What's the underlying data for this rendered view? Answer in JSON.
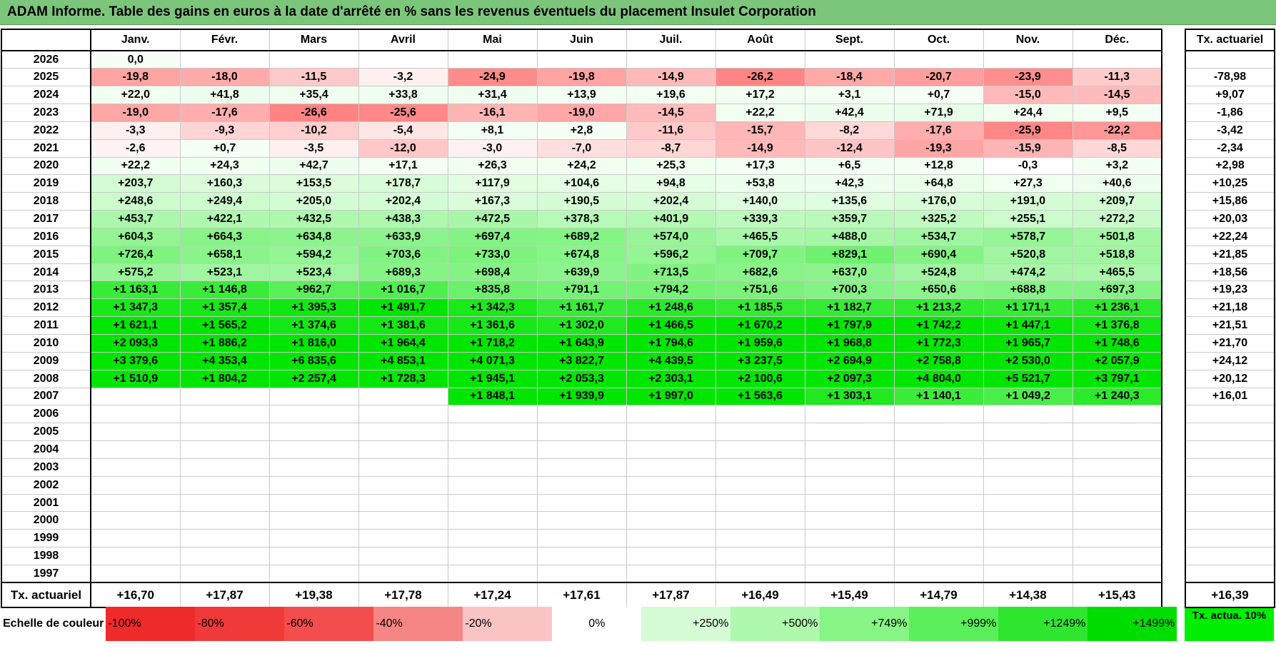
{
  "title": "ADAM Informe. Table des gains en euros à la date d'arrêté en % sans les revenus éventuels du placement Insulet Corporation",
  "chart_data": {
    "type": "table",
    "columns": [
      "Janv.",
      "Févr.",
      "Mars",
      "Avril",
      "Mai",
      "Juin",
      "Juil.",
      "Août",
      "Sept.",
      "Oct.",
      "Nov.",
      "Déc."
    ],
    "rate_header": "Tx. actuariel",
    "rows": [
      {
        "year": "2026",
        "values": [
          "0,0",
          "",
          "",
          "",
          "",
          "",
          "",
          "",
          "",
          "",
          "",
          ""
        ],
        "rate": ""
      },
      {
        "year": "2025",
        "values": [
          "-19,8",
          "-18,0",
          "-11,5",
          "-3,2",
          "-24,9",
          "-19,8",
          "-14,9",
          "-26,2",
          "-18,4",
          "-20,7",
          "-23,9",
          "-11,3"
        ],
        "rate": "-78,98"
      },
      {
        "year": "2024",
        "values": [
          "+22,0",
          "+41,8",
          "+35,4",
          "+33,8",
          "+31,4",
          "+13,9",
          "+19,6",
          "+17,2",
          "+3,1",
          "+0,7",
          "-15,0",
          "-14,5"
        ],
        "rate": "+9,07"
      },
      {
        "year": "2023",
        "values": [
          "-19,0",
          "-17,6",
          "-26,6",
          "-25,6",
          "-16,1",
          "-19,0",
          "-14,5",
          "+22,2",
          "+42,4",
          "+71,9",
          "+24,4",
          "+9,5"
        ],
        "rate": "-1,86"
      },
      {
        "year": "2022",
        "values": [
          "-3,3",
          "-9,3",
          "-10,2",
          "-5,4",
          "+8,1",
          "+2,8",
          "-11,6",
          "-15,7",
          "-8,2",
          "-17,6",
          "-25,9",
          "-22,2"
        ],
        "rate": "-3,42"
      },
      {
        "year": "2021",
        "values": [
          "-2,6",
          "+0,7",
          "-3,5",
          "-12,0",
          "-3,0",
          "-7,0",
          "-8,7",
          "-14,9",
          "-12,4",
          "-19,3",
          "-15,9",
          "-8,5"
        ],
        "rate": "-2,34"
      },
      {
        "year": "2020",
        "values": [
          "+22,2",
          "+24,3",
          "+42,7",
          "+17,1",
          "+26,3",
          "+24,2",
          "+25,3",
          "+17,3",
          "+6,5",
          "+12,8",
          "-0,3",
          "+3,2"
        ],
        "rate": "+2,98"
      },
      {
        "year": "2019",
        "values": [
          "+203,7",
          "+160,3",
          "+153,5",
          "+178,7",
          "+117,9",
          "+104,6",
          "+94,8",
          "+53,8",
          "+42,3",
          "+64,8",
          "+27,3",
          "+40,6"
        ],
        "rate": "+10,25"
      },
      {
        "year": "2018",
        "values": [
          "+248,6",
          "+249,4",
          "+205,0",
          "+202,4",
          "+167,3",
          "+190,5",
          "+202,4",
          "+140,0",
          "+135,6",
          "+176,0",
          "+191,0",
          "+209,7"
        ],
        "rate": "+15,86"
      },
      {
        "year": "2017",
        "values": [
          "+453,7",
          "+422,1",
          "+432,5",
          "+438,3",
          "+472,5",
          "+378,3",
          "+401,9",
          "+339,3",
          "+359,7",
          "+325,2",
          "+255,1",
          "+272,2"
        ],
        "rate": "+20,03"
      },
      {
        "year": "2016",
        "values": [
          "+604,3",
          "+664,3",
          "+634,8",
          "+633,9",
          "+697,4",
          "+689,2",
          "+574,0",
          "+465,5",
          "+488,0",
          "+534,7",
          "+578,7",
          "+501,8"
        ],
        "rate": "+22,24"
      },
      {
        "year": "2015",
        "values": [
          "+726,4",
          "+658,1",
          "+594,2",
          "+703,6",
          "+733,0",
          "+674,8",
          "+596,2",
          "+709,7",
          "+829,1",
          "+690,4",
          "+520,8",
          "+518,8"
        ],
        "rate": "+21,85"
      },
      {
        "year": "2014",
        "values": [
          "+575,2",
          "+523,1",
          "+523,4",
          "+689,3",
          "+698,4",
          "+639,9",
          "+713,5",
          "+682,6",
          "+637,0",
          "+524,8",
          "+474,2",
          "+465,5"
        ],
        "rate": "+18,56"
      },
      {
        "year": "2013",
        "values": [
          "+1 163,1",
          "+1 146,8",
          "+962,7",
          "+1 016,7",
          "+835,8",
          "+791,1",
          "+794,2",
          "+751,6",
          "+700,3",
          "+650,6",
          "+688,8",
          "+697,3"
        ],
        "rate": "+19,23"
      },
      {
        "year": "2012",
        "values": [
          "+1 347,3",
          "+1 357,4",
          "+1 395,3",
          "+1 491,7",
          "+1 342,3",
          "+1 161,7",
          "+1 248,6",
          "+1 185,5",
          "+1 182,7",
          "+1 213,2",
          "+1 171,1",
          "+1 236,1"
        ],
        "rate": "+21,18"
      },
      {
        "year": "2011",
        "values": [
          "+1 621,1",
          "+1 565,2",
          "+1 374,6",
          "+1 381,6",
          "+1 361,6",
          "+1 302,0",
          "+1 466,5",
          "+1 670,2",
          "+1 797,9",
          "+1 742,2",
          "+1 447,1",
          "+1 376,8"
        ],
        "rate": "+21,51"
      },
      {
        "year": "2010",
        "values": [
          "+2 093,3",
          "+1 886,2",
          "+1 816,0",
          "+1 964,4",
          "+1 718,2",
          "+1 643,9",
          "+1 794,6",
          "+1 959,6",
          "+1 968,8",
          "+1 772,3",
          "+1 965,7",
          "+1 748,6"
        ],
        "rate": "+21,70"
      },
      {
        "year": "2009",
        "values": [
          "+3 379,6",
          "+4 353,4",
          "+6 835,6",
          "+4 853,1",
          "+4 071,3",
          "+3 822,7",
          "+4 439,5",
          "+3 237,5",
          "+2 694,9",
          "+2 758,8",
          "+2 530,0",
          "+2 057,9"
        ],
        "rate": "+24,12"
      },
      {
        "year": "2008",
        "values": [
          "+1 510,9",
          "+1 804,2",
          "+2 257,4",
          "+1 728,3",
          "+1 945,1",
          "+2 053,3",
          "+2 303,1",
          "+2 100,6",
          "+2 097,3",
          "+4 804,0",
          "+5 521,7",
          "+3 797,1"
        ],
        "rate": "+20,12"
      },
      {
        "year": "2007",
        "values": [
          "",
          "",
          "",
          "",
          "+1 848,1",
          "+1 939,9",
          "+1 997,0",
          "+1 563,6",
          "+1 303,1",
          "+1 140,1",
          "+1 049,2",
          "+1 240,3"
        ],
        "rate": "+16,01"
      },
      {
        "year": "2006",
        "values": [
          "",
          "",
          "",
          "",
          "",
          "",
          "",
          "",
          "",
          "",
          "",
          ""
        ],
        "rate": ""
      },
      {
        "year": "2005",
        "values": [
          "",
          "",
          "",
          "",
          "",
          "",
          "",
          "",
          "",
          "",
          "",
          ""
        ],
        "rate": ""
      },
      {
        "year": "2004",
        "values": [
          "",
          "",
          "",
          "",
          "",
          "",
          "",
          "",
          "",
          "",
          "",
          ""
        ],
        "rate": ""
      },
      {
        "year": "2003",
        "values": [
          "",
          "",
          "",
          "",
          "",
          "",
          "",
          "",
          "",
          "",
          "",
          ""
        ],
        "rate": ""
      },
      {
        "year": "2002",
        "values": [
          "",
          "",
          "",
          "",
          "",
          "",
          "",
          "",
          "",
          "",
          "",
          ""
        ],
        "rate": ""
      },
      {
        "year": "2001",
        "values": [
          "",
          "",
          "",
          "",
          "",
          "",
          "",
          "",
          "",
          "",
          "",
          ""
        ],
        "rate": ""
      },
      {
        "year": "2000",
        "values": [
          "",
          "",
          "",
          "",
          "",
          "",
          "",
          "",
          "",
          "",
          "",
          ""
        ],
        "rate": ""
      },
      {
        "year": "1999",
        "values": [
          "",
          "",
          "",
          "",
          "",
          "",
          "",
          "",
          "",
          "",
          "",
          ""
        ],
        "rate": ""
      },
      {
        "year": "1998",
        "values": [
          "",
          "",
          "",
          "",
          "",
          "",
          "",
          "",
          "",
          "",
          "",
          ""
        ],
        "rate": ""
      },
      {
        "year": "1997",
        "values": [
          "",
          "",
          "",
          "",
          "",
          "",
          "",
          "",
          "",
          "",
          "",
          ""
        ],
        "rate": ""
      }
    ],
    "footer_label": "Tx. actuariel",
    "footer_values": [
      "+16,70",
      "+17,87",
      "+19,38",
      "+17,78",
      "+17,24",
      "+17,61",
      "+17,87",
      "+16,49",
      "+15,49",
      "+14,79",
      "+14,38",
      "+15,43"
    ],
    "footer_rate": "+16,39",
    "scale_label": "Echelle de couleur",
    "scale": [
      {
        "label": "-100%",
        "color": "#ee2a2a"
      },
      {
        "label": "-80%",
        "color": "#f03a3a"
      },
      {
        "label": "-60%",
        "color": "#f34d4d"
      },
      {
        "label": "-40%",
        "color": "#f68686"
      },
      {
        "label": "-20%",
        "color": "#fbc4c4"
      },
      {
        "label": "0%",
        "color": "#ffffff"
      },
      {
        "label": "+250%",
        "color": "#d6fcd6"
      },
      {
        "label": "+500%",
        "color": "#aef9ae"
      },
      {
        "label": "+749%",
        "color": "#86f586"
      },
      {
        "label": "+999%",
        "color": "#5aef5a"
      },
      {
        "label": "+1249%",
        "color": "#2fe62f"
      },
      {
        "label": "+1499%",
        "color": "#00dd00"
      }
    ],
    "rate_legend": "Tx. actua. 10%",
    "rate_legend_color": "#00ee00"
  }
}
